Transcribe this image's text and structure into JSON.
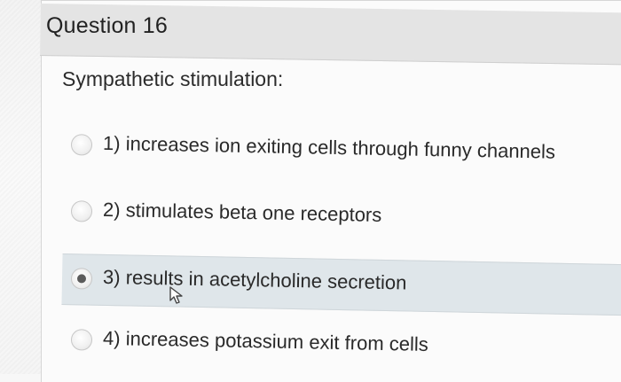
{
  "question": {
    "title": "Question 16",
    "prompt": "Sympathetic stimulation:"
  },
  "answers": [
    {
      "label": "1) increases ion exiting cells through funny channels",
      "selected": false
    },
    {
      "label": "2) stimulates beta one receptors",
      "selected": false
    },
    {
      "label": "3) results in acetylcholine secretion",
      "selected": true
    },
    {
      "label": "4) increases potassium exit from cells",
      "selected": false
    }
  ],
  "icons": {
    "cursor": "mouse-pointer-icon",
    "radio": "radio-button-icon"
  },
  "colors": {
    "selected_row_bg": "#dfe6ea",
    "header_bg": "#e4e4e4"
  }
}
